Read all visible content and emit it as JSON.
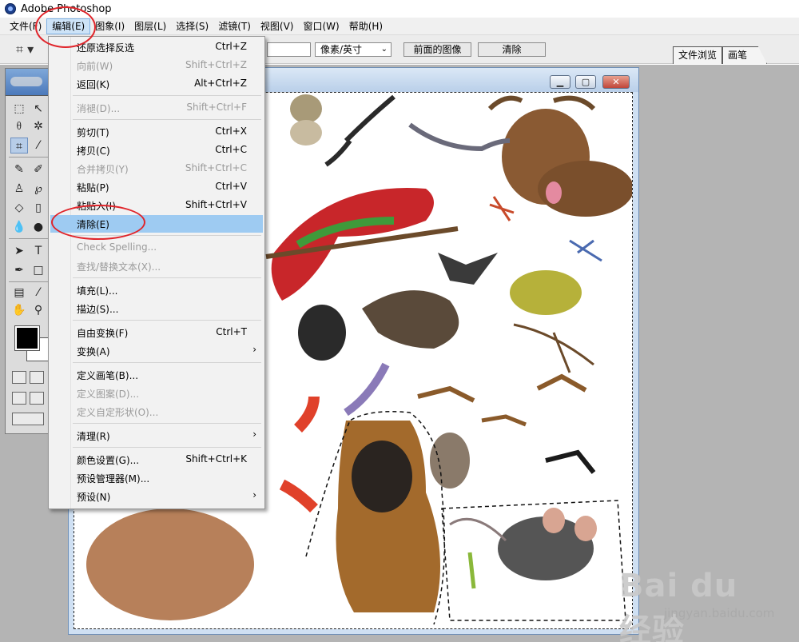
{
  "app": {
    "title": "Adobe Photoshop"
  },
  "menubar": {
    "items": [
      {
        "label": "文件(F)"
      },
      {
        "label": "编辑(E)"
      },
      {
        "label": "图象(I)"
      },
      {
        "label": "图层(L)"
      },
      {
        "label": "选择(S)"
      },
      {
        "label": "滤镜(T)"
      },
      {
        "label": "视图(V)"
      },
      {
        "label": "窗口(W)"
      },
      {
        "label": "帮助(H)"
      }
    ]
  },
  "options_bar": {
    "unit_select": "像素/英寸",
    "front_image_button": "前面的图像",
    "clear_button": "清除",
    "palette_tabs": [
      "文件浏览",
      "画笔"
    ]
  },
  "edit_menu": {
    "items": [
      {
        "label": "还原选择反选",
        "shortcut": "Ctrl+Z",
        "enabled": true
      },
      {
        "label": "向前(W)",
        "shortcut": "Shift+Ctrl+Z",
        "enabled": false
      },
      {
        "label": "返回(K)",
        "shortcut": "Alt+Ctrl+Z",
        "enabled": true
      },
      {
        "label": "消褪(D)...",
        "shortcut": "Shift+Ctrl+F",
        "enabled": false
      },
      {
        "label": "剪切(T)",
        "shortcut": "Ctrl+X",
        "enabled": true
      },
      {
        "label": "拷贝(C)",
        "shortcut": "Ctrl+C",
        "enabled": true
      },
      {
        "label": "合并拷贝(Y)",
        "shortcut": "Shift+Ctrl+C",
        "enabled": false
      },
      {
        "label": "粘贴(P)",
        "shortcut": "Ctrl+V",
        "enabled": true
      },
      {
        "label": "粘贴入(I)",
        "shortcut": "Shift+Ctrl+V",
        "enabled": true
      },
      {
        "label": "清除(E)",
        "shortcut": "",
        "enabled": true,
        "highlighted": true
      },
      {
        "label": "Check Spelling...",
        "shortcut": "",
        "enabled": false
      },
      {
        "label": "查找/替换文本(X)...",
        "shortcut": "",
        "enabled": false
      },
      {
        "label": "填充(L)...",
        "shortcut": "",
        "enabled": true
      },
      {
        "label": "描边(S)...",
        "shortcut": "",
        "enabled": true
      },
      {
        "label": "自由变换(F)",
        "shortcut": "Ctrl+T",
        "enabled": true
      },
      {
        "label": "变换(A)",
        "shortcut": "",
        "enabled": true,
        "submenu": true
      },
      {
        "label": "定义画笔(B)...",
        "shortcut": "",
        "enabled": true
      },
      {
        "label": "定义图案(D)...",
        "shortcut": "",
        "enabled": false
      },
      {
        "label": "定义自定形状(O)...",
        "shortcut": "",
        "enabled": false
      },
      {
        "label": "清理(R)",
        "shortcut": "",
        "enabled": true,
        "submenu": true
      },
      {
        "label": "颜色设置(G)...",
        "shortcut": "Shift+Ctrl+K",
        "enabled": true
      },
      {
        "label": "预设管理器(M)...",
        "shortcut": "",
        "enabled": true
      },
      {
        "label": "预设(N)",
        "shortcut": "",
        "enabled": true,
        "submenu": true
      }
    ],
    "submenu_arrow": "›"
  },
  "watermark": {
    "brand": "Bai du 经验",
    "url": "jingyan.baidu.com"
  },
  "colors": {
    "highlight": "#9ecbf2",
    "annotation": "#e0242a",
    "workspace": "#b4b4b4"
  }
}
